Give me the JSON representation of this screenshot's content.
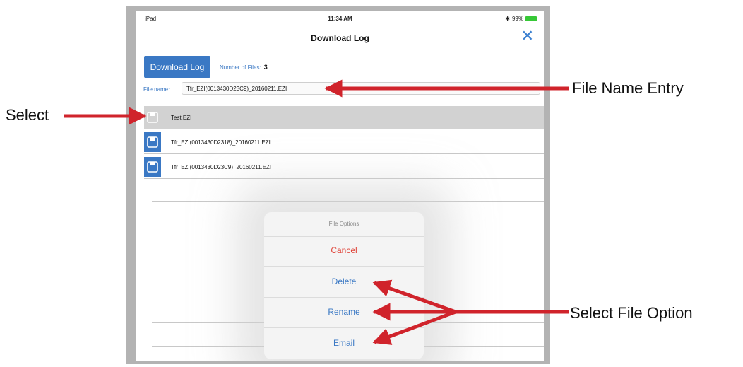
{
  "status_bar": {
    "device": "iPad",
    "time": "11:34 AM",
    "battery": "99%"
  },
  "nav": {
    "title": "Download Log"
  },
  "toolbar": {
    "download_label": "Download Log",
    "number_of_files_label": "Number of Files:",
    "number_of_files_value": "3"
  },
  "file_name": {
    "label": "File name:",
    "value": "Tfr_EZI(0013430D23C9)_20160211.EZI"
  },
  "files": [
    {
      "name": "Test.EZI"
    },
    {
      "name": "Tfr_EZI(0013430D2318)_20160211.EZI"
    },
    {
      "name": "Tfr_EZI(0013430D23C9)_20160211.EZI"
    }
  ],
  "file_options": {
    "title": "File Options",
    "cancel": "Cancel",
    "delete": "Delete",
    "rename": "Rename",
    "email": "Email"
  },
  "callouts": {
    "select": "Select",
    "file_name_entry": "File Name Entry",
    "select_file_option": "Select  File Option"
  },
  "colors": {
    "accent": "#3a78c4",
    "cancel": "#e0453a",
    "arrow": "#d0232b"
  }
}
